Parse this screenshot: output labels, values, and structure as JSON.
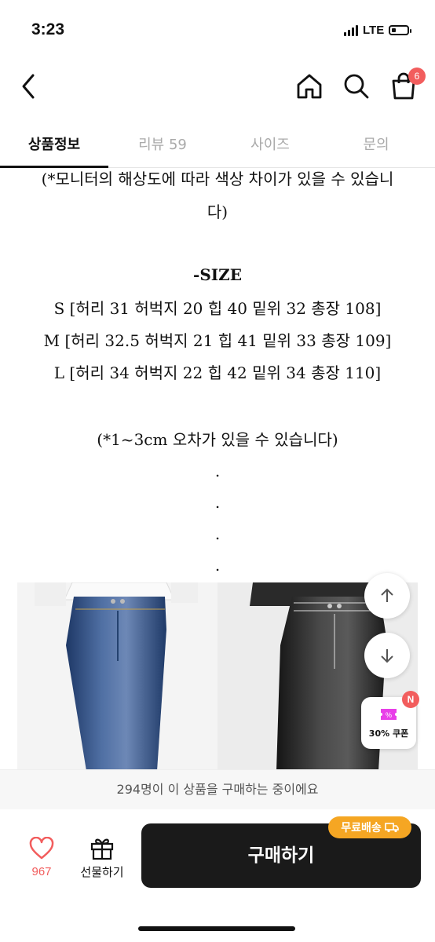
{
  "status_bar": {
    "time": "3:23",
    "network": "LTE",
    "battery_level": 0.25
  },
  "header": {
    "cart_count": "6",
    "icons": [
      "back-icon",
      "home-icon",
      "search-icon",
      "cart-icon"
    ]
  },
  "tabs": [
    {
      "label": "상품정보",
      "active": true
    },
    {
      "label": "리뷰 59",
      "active": false
    },
    {
      "label": "사이즈",
      "active": false
    },
    {
      "label": "문의",
      "active": false
    }
  ],
  "content": {
    "monitor_note_line1": "(*모니터의 해상도에 따라 색상 차이가 있을 수 있습니",
    "monitor_note_line2": "다)",
    "size_heading": "-SIZE",
    "size_rows": [
      "S [허리 31 허벅지 20 힙 40 밑위 32 총장 108]",
      "M [허리 32.5 허벅지 21 힙 41 밑위 33 총장 109]",
      "L [허리 34 허벅지 22 힙 42 밑위 34 총장 110]"
    ],
    "tolerance_note": "(*1~3cm 오차가 있을 수 있습니다)",
    "dots": [
      ".",
      ".",
      ".",
      "."
    ]
  },
  "floating": {
    "coupon_label": "30% 쿠폰",
    "coupon_badge": "N"
  },
  "notice": "294명이 이 상품을 구매하는 중이에요",
  "bottom_bar": {
    "like_count": "967",
    "gift_label": "선물하기",
    "buy_label": "구매하기",
    "free_shipping_label": "무료배송"
  },
  "colors": {
    "accent_red": "#f25d5d",
    "free_ship_orange": "#f5a623",
    "buy_button": "#1a1a1a"
  }
}
